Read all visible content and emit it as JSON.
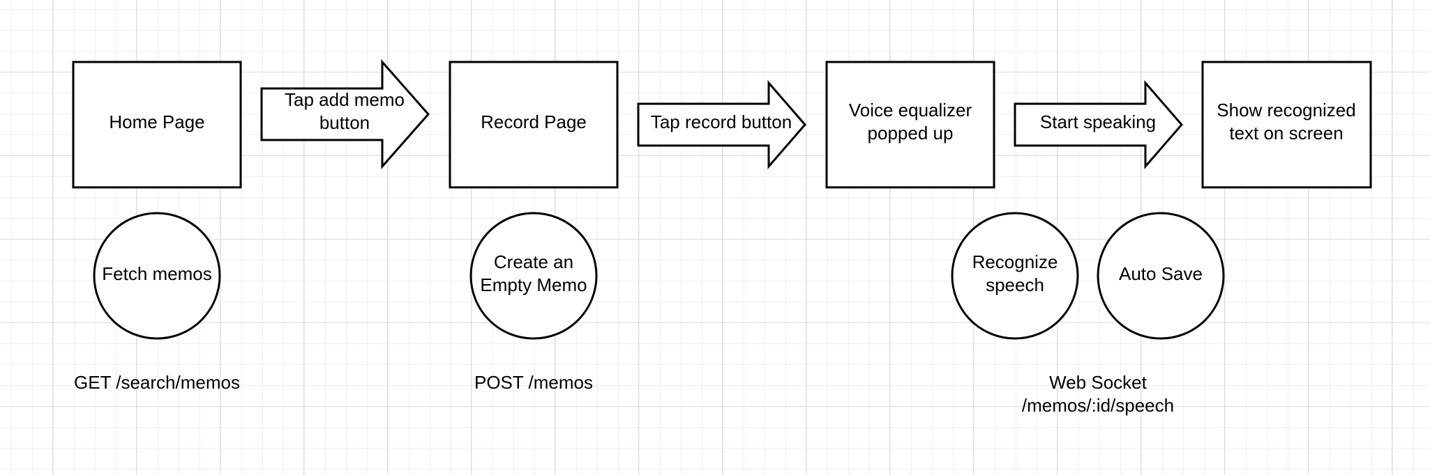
{
  "boxes": {
    "home": "Home Page",
    "record": "Record Page",
    "voice": [
      "Voice equalizer",
      "popped up"
    ],
    "show": [
      "Show recognized",
      "text on screen"
    ]
  },
  "arrows": {
    "tap_add": [
      "Tap add memo",
      "button"
    ],
    "tap_record": "Tap record button",
    "start_speaking": "Start speaking"
  },
  "circles": {
    "fetch": "Fetch memos",
    "create": [
      "Create an",
      "Empty Memo"
    ],
    "recognize": [
      "Recognize",
      "speech"
    ],
    "autosave": "Auto Save"
  },
  "labels": {
    "get": "GET /search/memos",
    "post": "POST /memos",
    "websocket": [
      "Web Socket",
      "/memos/:id/speech"
    ]
  },
  "colors": {
    "stroke": "#000000",
    "grid": "#dcdcdc",
    "background": "#ffffff"
  }
}
